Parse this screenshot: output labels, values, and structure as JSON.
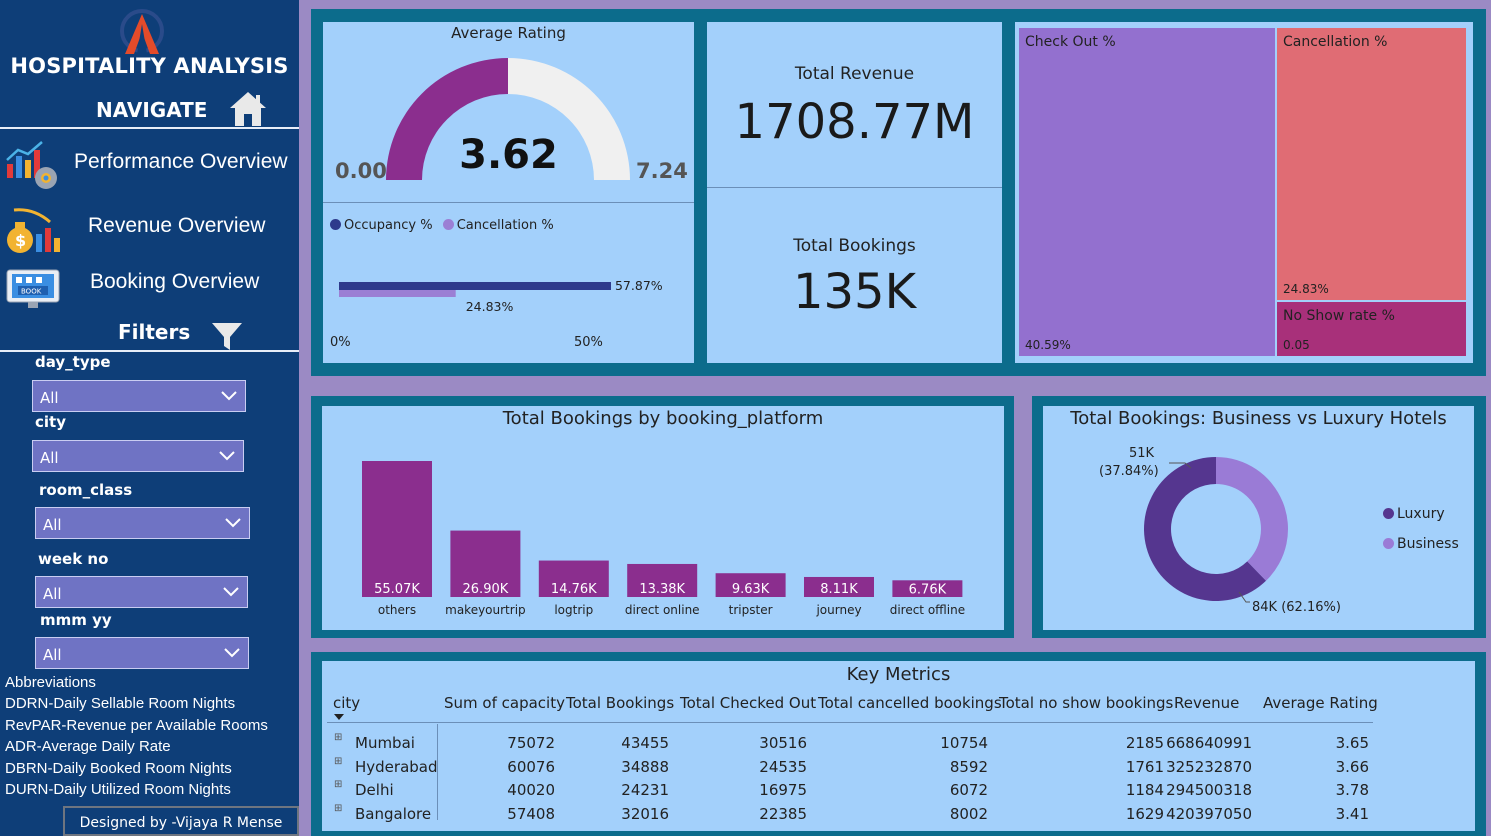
{
  "sidebar": {
    "app_title": "HOSPITALITY ANALYSIS",
    "navigate_label": "NAVIGATE",
    "nav_items": [
      {
        "label": "Performance Overview",
        "icon": "performance-chart-icon"
      },
      {
        "label": "Revenue Overview",
        "icon": "money-bag-icon"
      },
      {
        "label": "Booking Overview",
        "icon": "booking-monitor-icon"
      }
    ],
    "filters_label": "Filters",
    "filters": [
      {
        "label": "day_type",
        "value": "All"
      },
      {
        "label": "city",
        "value": "All"
      },
      {
        "label": "room_class",
        "value": "All"
      },
      {
        "label": "week no",
        "value": "All"
      },
      {
        "label": "mmm yy",
        "value": "All"
      }
    ],
    "abbreviations_title": "Abbreviations",
    "abbreviations": [
      "DDRN-Daily Sellable Room Nights",
      "RevPAR-Revenue per Available Rooms",
      "ADR-Average Daily Rate",
      "DBRN-Daily Booked Room Nights",
      "DURN-Daily Utilized Room Nights"
    ],
    "designed_by": "Designed by -Vijaya R Mense"
  },
  "colors": {
    "sidebar_bg": "#0e3e78",
    "frame": "#0c6c8c",
    "panel": "#a3d0fb",
    "purple_dark": "#8b2e8e",
    "occupancy": "#2e3a8c",
    "cancellation": "#9b7fd4",
    "checkout": "#9370cf",
    "cancel_tm": "#e06c74",
    "noshow_tm": "#a8307a",
    "luxury": "#55368f",
    "business": "#9a7bd6"
  },
  "gauge": {
    "title": "Average Rating",
    "value_text": "3.62",
    "value": 3.62,
    "min_text": "0.00",
    "max_text": "7.24",
    "min": 0,
    "max": 7.24
  },
  "occupancy_chart": {
    "legend": [
      "Occupancy %",
      "Cancellation %"
    ],
    "bars": [
      {
        "name": "Occupancy %",
        "value": 57.87,
        "label": "57.87%"
      },
      {
        "name": "Cancellation %",
        "value": 24.83,
        "label": "24.83%"
      }
    ],
    "axis_ticks": [
      "0%",
      "50%"
    ]
  },
  "kpis": {
    "revenue_label": "Total Revenue",
    "revenue_value": "1708.77M",
    "bookings_label": "Total Bookings",
    "bookings_value": "135K"
  },
  "treemap": {
    "cells": [
      {
        "name": "Check Out %",
        "value": "40.59%"
      },
      {
        "name": "Cancellation %",
        "value": "24.83%"
      },
      {
        "name": "No Show rate %",
        "value": "0.05"
      }
    ]
  },
  "chart_data": [
    {
      "type": "bar",
      "title": "Total Bookings by booking_platform",
      "categories": [
        "others",
        "makeyourtrip",
        "logtrip",
        "direct online",
        "tripster",
        "journey",
        "direct offline"
      ],
      "values": [
        55.07,
        26.9,
        14.76,
        13.38,
        9.63,
        8.11,
        6.76
      ],
      "value_labels": [
        "55.07K",
        "26.90K",
        "14.76K",
        "13.38K",
        "9.63K",
        "8.11K",
        "6.76K"
      ],
      "ylim": [
        0,
        60
      ]
    },
    {
      "type": "pie",
      "title": "Total Bookings: Business vs Luxury Hotels",
      "categories": [
        "Luxury",
        "Business"
      ],
      "values": [
        84,
        51
      ],
      "percents": [
        62.16,
        37.84
      ],
      "slice_labels": [
        "84K (62.16%)",
        "51K (37.84%)"
      ],
      "label_top_value": "51K",
      "label_top_pct": "(37.84%)",
      "legend": [
        "Luxury",
        "Business"
      ]
    }
  ],
  "table": {
    "title": "Key Metrics",
    "columns": [
      "city",
      "Sum of capacity",
      "Total Bookings",
      "Total Checked Out",
      "Total cancelled bookings",
      "Total no show bookings",
      "Revenue",
      "Average Rating"
    ],
    "rows": [
      [
        "Mumbai",
        "75072",
        "43455",
        "30516",
        "10754",
        "2185",
        "668640991",
        "3.65"
      ],
      [
        "Hyderabad",
        "60076",
        "34888",
        "24535",
        "8592",
        "1761",
        "325232870",
        "3.66"
      ],
      [
        "Delhi",
        "40020",
        "24231",
        "16975",
        "6072",
        "1184",
        "294500318",
        "3.78"
      ],
      [
        "Bangalore",
        "57408",
        "32016",
        "22385",
        "8002",
        "1629",
        "420397050",
        "3.41"
      ]
    ]
  }
}
